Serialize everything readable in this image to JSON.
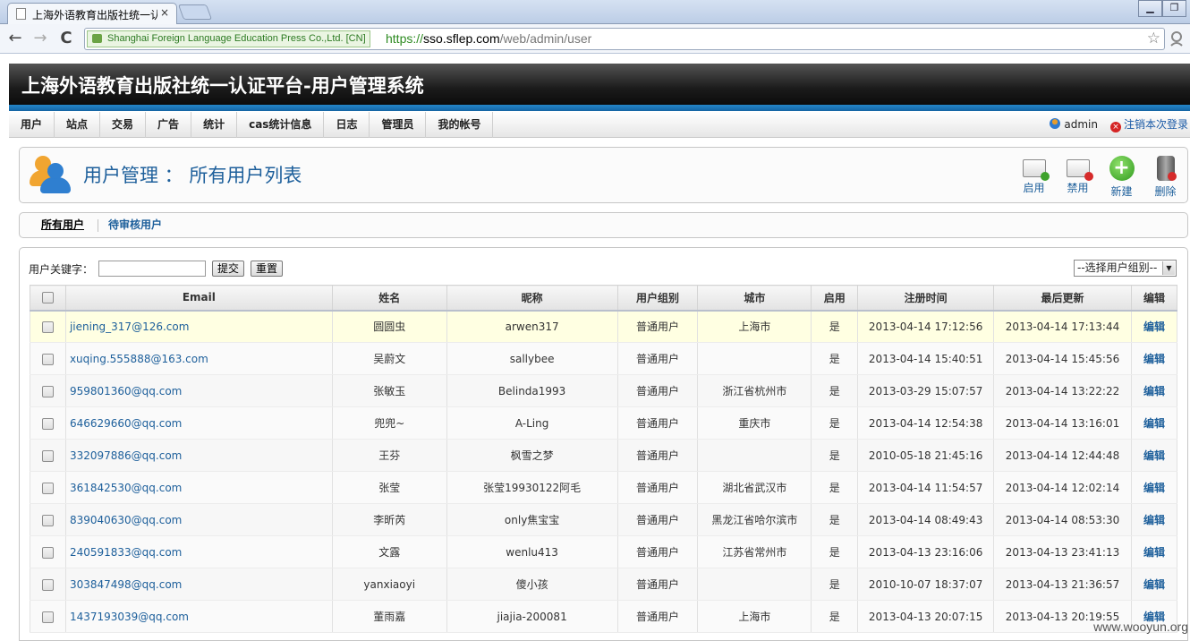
{
  "browser": {
    "tab_title": "上海外语教育出版社统一认",
    "tab_close": "×",
    "win_minimize": "▁",
    "win_restore": "❐",
    "back": "←",
    "forward": "→",
    "reload": "C",
    "ev_label": "Shanghai Foreign Language Education Press Co.,Ltd. [CN]",
    "url_scheme": "https://",
    "url_host": "sso.sflep.com",
    "url_path": "/web/admin/user",
    "star": "☆"
  },
  "header": {
    "title": "上海外语教育出版社统一认证平台-用户管理系统"
  },
  "mainnav": {
    "items": [
      "用户",
      "站点",
      "交易",
      "广告",
      "统计",
      "cas统计信息",
      "日志",
      "管理员",
      "我的帐号"
    ],
    "username": "admin",
    "logout": "注销本次登录"
  },
  "titlebox": {
    "title": "用户管理 ： 所有用户列表",
    "actions": [
      "启用",
      "禁用",
      "新建",
      "删除"
    ]
  },
  "subtabs": [
    "所有用户",
    "待审核用户"
  ],
  "search": {
    "label": "用户关键字：",
    "input_value": "",
    "submit": "提交",
    "reset": "重置",
    "group_select": "--选择用户组别--"
  },
  "table": {
    "headers": [
      "Email",
      "姓名",
      "昵称",
      "用户组别",
      "城市",
      "启用",
      "注册时间",
      "最后更新",
      "编辑"
    ],
    "rows": [
      {
        "email": "jiening_317@126.com",
        "name": "圆圆虫",
        "nick": "arwen317",
        "group": "普通用户",
        "city": "上海市",
        "enabled": "是",
        "registered": "2013-04-14 17:12:56",
        "updated": "2013-04-14 17:13:44",
        "edit": "编辑"
      },
      {
        "email": "xuqing.555888@163.com",
        "name": "吴蔚文",
        "nick": "sallybee",
        "group": "普通用户",
        "city": "",
        "enabled": "是",
        "registered": "2013-04-14 15:40:51",
        "updated": "2013-04-14 15:45:56",
        "edit": "编辑"
      },
      {
        "email": "959801360@qq.com",
        "name": "张敏玉",
        "nick": "Belinda1993",
        "group": "普通用户",
        "city": "浙江省杭州市",
        "enabled": "是",
        "registered": "2013-03-29 15:07:57",
        "updated": "2013-04-14 13:22:22",
        "edit": "编辑"
      },
      {
        "email": "646629660@qq.com",
        "name": "兜兜~",
        "nick": "A-Ling",
        "group": "普通用户",
        "city": "重庆市",
        "enabled": "是",
        "registered": "2013-04-14 12:54:38",
        "updated": "2013-04-14 13:16:01",
        "edit": "编辑"
      },
      {
        "email": "332097886@qq.com",
        "name": "王芬",
        "nick": "枫雪之梦",
        "group": "普通用户",
        "city": "",
        "enabled": "是",
        "registered": "2010-05-18 21:45:16",
        "updated": "2013-04-14 12:44:48",
        "edit": "编辑"
      },
      {
        "email": "361842530@qq.com",
        "name": "张莹",
        "nick": "张莹19930122阿毛",
        "group": "普通用户",
        "city": "湖北省武汉市",
        "enabled": "是",
        "registered": "2013-04-14 11:54:57",
        "updated": "2013-04-14 12:02:14",
        "edit": "编辑"
      },
      {
        "email": "839040630@qq.com",
        "name": "李昕芮",
        "nick": "only焦宝宝",
        "group": "普通用户",
        "city": "黑龙江省哈尔滨市",
        "enabled": "是",
        "registered": "2013-04-14 08:49:43",
        "updated": "2013-04-14 08:53:30",
        "edit": "编辑"
      },
      {
        "email": "240591833@qq.com",
        "name": "文露",
        "nick": "wenlu413",
        "group": "普通用户",
        "city": "江苏省常州市",
        "enabled": "是",
        "registered": "2013-04-13 23:16:06",
        "updated": "2013-04-13 23:41:13",
        "edit": "编辑"
      },
      {
        "email": "303847498@qq.com",
        "name": "yanxiaoyi",
        "nick": "傻小孩",
        "group": "普通用户",
        "city": "",
        "enabled": "是",
        "registered": "2010-10-07 18:37:07",
        "updated": "2013-04-13 21:36:57",
        "edit": "编辑"
      },
      {
        "email": "1437193039@qq.com",
        "name": "董雨嘉",
        "nick": "jiajia-200081",
        "group": "普通用户",
        "city": "上海市",
        "enabled": "是",
        "registered": "2013-04-13 20:07:15",
        "updated": "2013-04-13 20:19:55",
        "edit": "编辑"
      }
    ]
  },
  "watermark": "www.wooyun.org"
}
